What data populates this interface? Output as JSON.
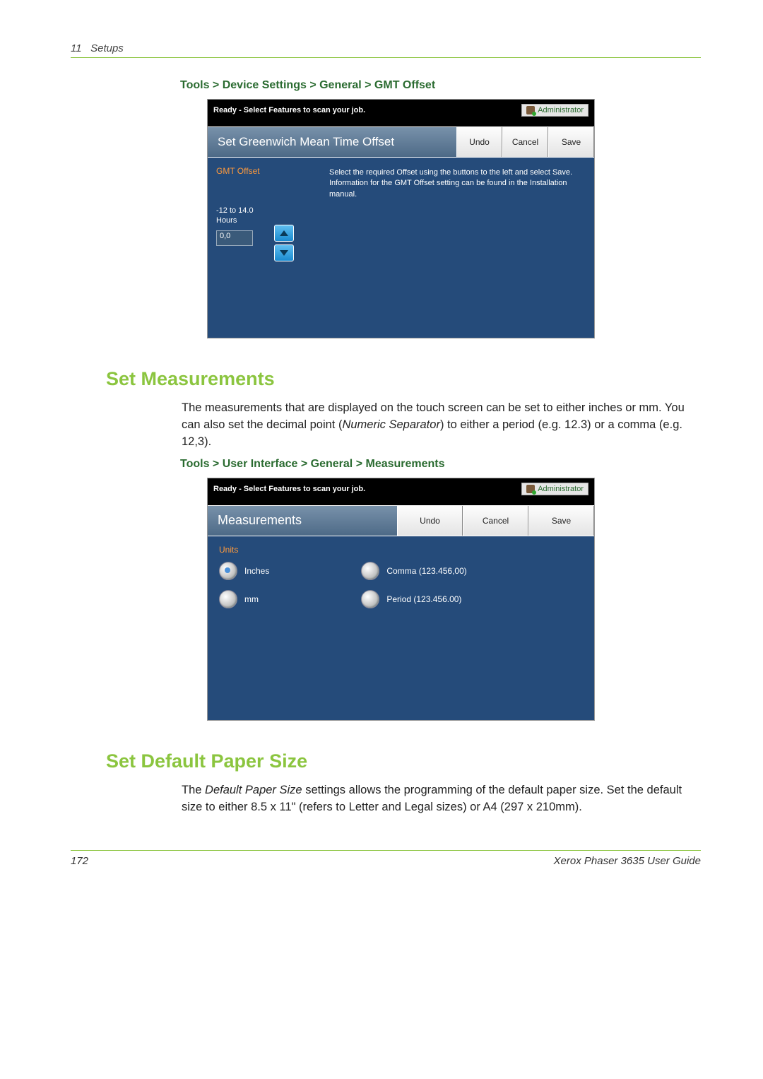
{
  "page_header": {
    "chapter_num": "11",
    "chapter_title": "Setups"
  },
  "breadcrumb1": "Tools > Device Settings > General > GMT Offset",
  "screenshot1": {
    "status_text": "Ready - Select Features to scan your job.",
    "admin_label": "Administrator",
    "title": "Set Greenwich Mean Time Offset",
    "buttons": {
      "undo": "Undo",
      "cancel": "Cancel",
      "save": "Save"
    },
    "gmt_offset_label": "GMT Offset",
    "range_line1": "-12 to 14.0",
    "range_line2": "Hours",
    "value": "0,0",
    "help_text": "Select the required Offset using the buttons to the left and select Save. Information for the GMT Offset setting can be found in the Installation manual."
  },
  "section1_heading": "Set Measurements",
  "section1_body_plain1": "The measurements that are displayed on the touch screen can be set to either inches or mm. You can also set the decimal point (",
  "section1_body_em": "Numeric Separator",
  "section1_body_plain2": ") to either a period (e.g. 12.3) or a comma (e.g. 12,3).",
  "breadcrumb2": "Tools > User Interface > General > Measurements",
  "screenshot2": {
    "status_text": "Ready - Select Features to scan your job.",
    "admin_label": "Administrator",
    "title": "Measurements",
    "buttons": {
      "undo": "Undo",
      "cancel": "Cancel",
      "save": "Save"
    },
    "units_label": "Units",
    "options_left": {
      "inches": "Inches",
      "mm": "mm"
    },
    "options_right": {
      "comma": "Comma (123.456,00)",
      "period": "Period (123.456.00)"
    }
  },
  "section2_heading": "Set Default Paper Size",
  "section2_body_plain1": "The ",
  "section2_body_em": "Default Paper Size",
  "section2_body_plain2": " settings allows the programming of the default paper size. Set the default size to either 8.5 x 11\" (refers to Letter and Legal sizes) or A4 (297 x 210mm).",
  "footer": {
    "page_num": "172",
    "guide": "Xerox Phaser 3635 User Guide"
  }
}
